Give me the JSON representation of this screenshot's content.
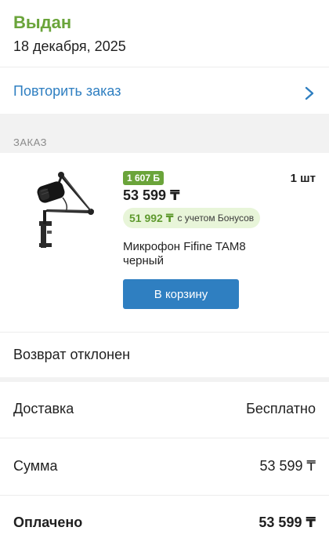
{
  "status": {
    "title": "Выдан",
    "date": "18 декабря, 2025"
  },
  "repeat_order": {
    "label": "Повторить заказ",
    "icon": "chevron-right-icon"
  },
  "order_section": {
    "label": "ЗАКАЗ"
  },
  "item": {
    "image": "microphone-product-image",
    "bonus_badge": "1 607 Б",
    "quantity": "1 шт",
    "price": "53 599 ₸",
    "bonus_price": "51 992 ₸",
    "bonus_note": "с учетом Бонусов",
    "name": "Микрофон Fifine TAM8 черный",
    "cart_button": "В корзину"
  },
  "return_status": "Возврат отклонен",
  "summary": {
    "delivery_label": "Доставка",
    "delivery_value": "Бесплатно",
    "sum_label": "Сумма",
    "sum_value": "53 599 ₸",
    "paid_label": "Оплачено",
    "paid_value": "53 599 ₸"
  },
  "colors": {
    "accent_green": "#6aa43a",
    "link_blue": "#2f7fc1",
    "bonus_bg": "#e8f5d9"
  }
}
